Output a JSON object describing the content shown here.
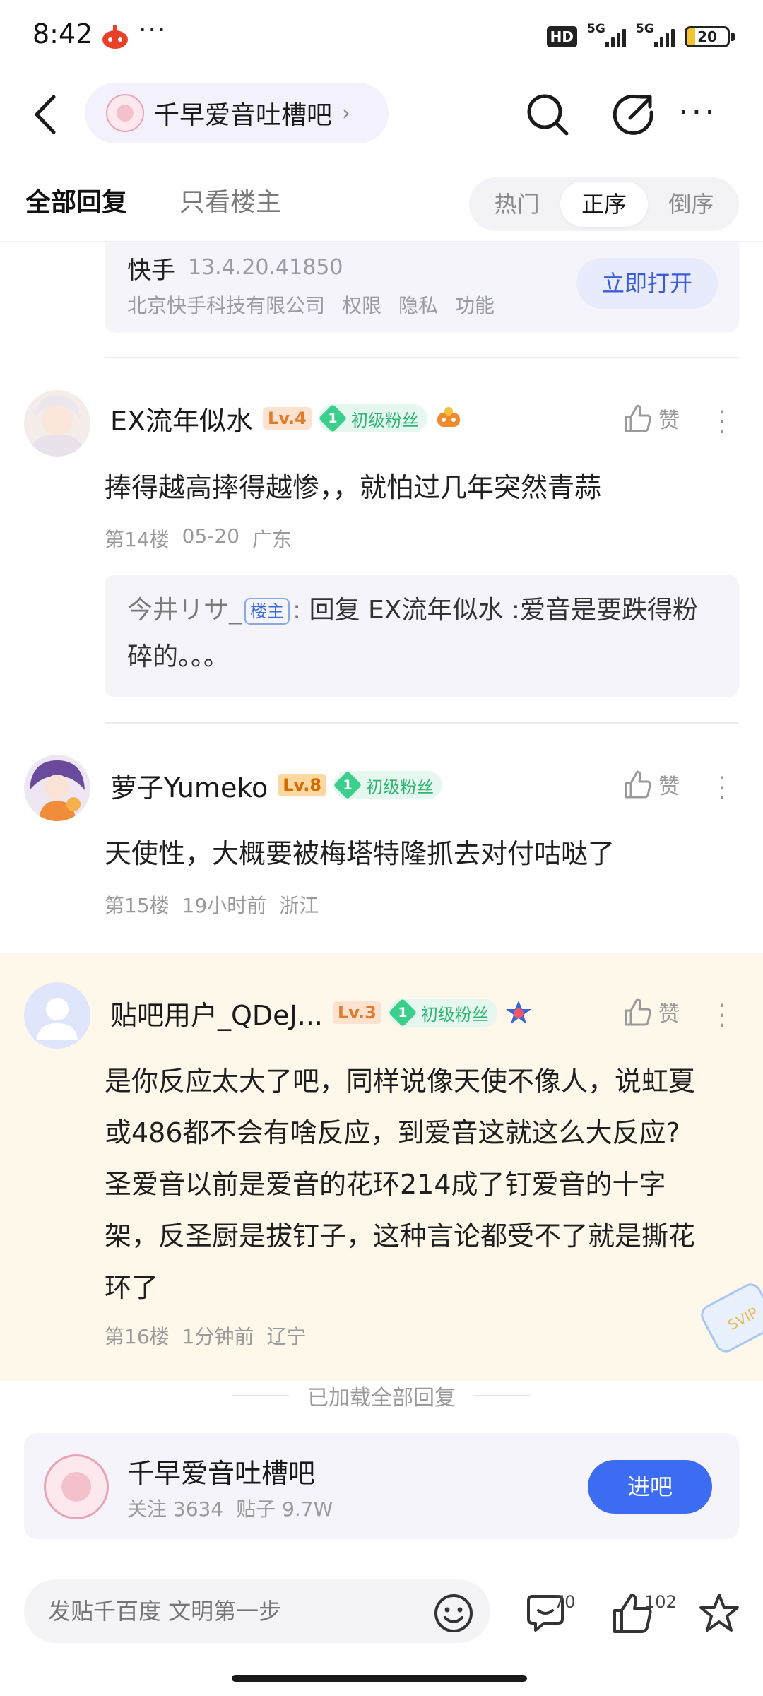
{
  "status_bar": {
    "time": "8:42",
    "dots": "···",
    "hd": "HD",
    "net1": "5G",
    "net2": "5G",
    "battery": "20"
  },
  "nav": {
    "forum_name": "千早爱音吐槽吧",
    "chevron": "›"
  },
  "tabs": {
    "all": "全部回复",
    "host_only": "只看楼主",
    "sort": [
      "热门",
      "正序",
      "倒序"
    ],
    "sort_active": "正序"
  },
  "app_card": {
    "name": "快手",
    "version": "13.4.20.41850",
    "company": "北京快手科技有限公司",
    "links": [
      "权限",
      "隐私",
      "功能"
    ],
    "open_label": "立即打开"
  },
  "posts": [
    {
      "username": "EX流年似水",
      "level": "Lv.4",
      "fan_num": "1",
      "fan_label": "初级粉丝",
      "like_label": "赞",
      "text": "捧得越高摔得越惨，，就怕过几年突然青蒜",
      "floor": "第14楼",
      "time": "05-20",
      "location": "广东",
      "reply": {
        "user": "今井リサ_",
        "badge": "楼主",
        "colon": ":",
        "text": "回复 EX流年似水 :爱音是要跌得粉碎的。。。"
      }
    },
    {
      "username": "萝子Yumeko",
      "level": "Lv.8",
      "fan_num": "1",
      "fan_label": "初级粉丝",
      "like_label": "赞",
      "text": "天使性，大概要被梅塔特隆抓去对付咕哒了",
      "floor": "第15楼",
      "time": "19小时前",
      "location": "浙江"
    },
    {
      "username": "贴吧用户_QDeJ...",
      "level": "Lv.3",
      "fan_num": "1",
      "fan_label": "初级粉丝",
      "like_label": "赞",
      "text_lines": [
        "是你反应太大了吧，同样说像天使不像人，说虹夏",
        "或486都不会有啥反应，到爱音这就这么大反应?",
        "圣爱音以前是爱音的花环214成了钉爱音的十字",
        "架，反圣厨是拔钉子，这种言论都受不了就是撕花",
        "环了"
      ],
      "floor": "第16楼",
      "time": "1分钟前",
      "location": "辽宁"
    }
  ],
  "loaded_all": "已加载全部回复",
  "forum_card": {
    "name": "千早爱音吐槽吧",
    "follow": "关注 3634",
    "posts": "贴子 9.7W",
    "enter_label": "进吧"
  },
  "bottom_bar": {
    "placeholder": "发贴千百度 文明第一步",
    "comment_count": "70",
    "like_count": "102"
  },
  "colors": {
    "accent": "#3b6cf2",
    "highlight_bg": "#fdf8ea",
    "fan_green": "#2bb673"
  }
}
